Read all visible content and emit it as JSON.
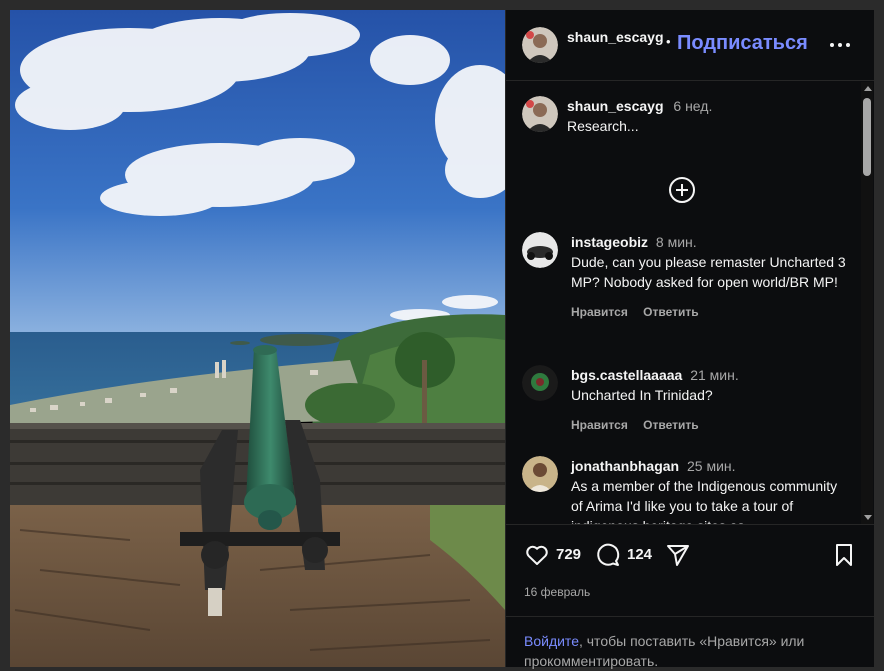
{
  "header": {
    "username": "shaun_escayg",
    "separator": "•",
    "follow_label": "Подписаться"
  },
  "caption": {
    "username": "shaun_escayg",
    "time": "6 нед.",
    "text": "Research..."
  },
  "comments": [
    {
      "username": "instageobiz",
      "time": "8 мин.",
      "text": "Dude, can you please remaster Uncharted 3 MP? Nobody asked for open world/BR MP!",
      "like_label": "Нравится",
      "reply_label": "Ответить"
    },
    {
      "username": "bgs.castellaaaaa",
      "time": "21 мин.",
      "text": "Uncharted In Trinidad?",
      "like_label": "Нравится",
      "reply_label": "Ответить"
    },
    {
      "username": "jonathanbhagan",
      "time": "25 мин.",
      "text": "As a member of the Indigenous community of Arima I'd like you to take a tour of indigenous heritage sites as"
    }
  ],
  "stats": {
    "likes": "729",
    "comments": "124"
  },
  "date": "16 февраль",
  "login": {
    "link": "Войдите",
    "text": ", чтобы поставить «Нравится» или прокомментировать."
  },
  "icons": {
    "more": "more-horizontal-icon",
    "load_more": "plus-circle-icon",
    "like": "heart-icon",
    "comment": "comment-bubble-icon",
    "share": "paper-plane-icon",
    "save": "bookmark-icon"
  },
  "colors": {
    "accent": "#7a8cff",
    "panel_bg": "#0c0d0f",
    "muted_text": "#a8a8a8"
  }
}
